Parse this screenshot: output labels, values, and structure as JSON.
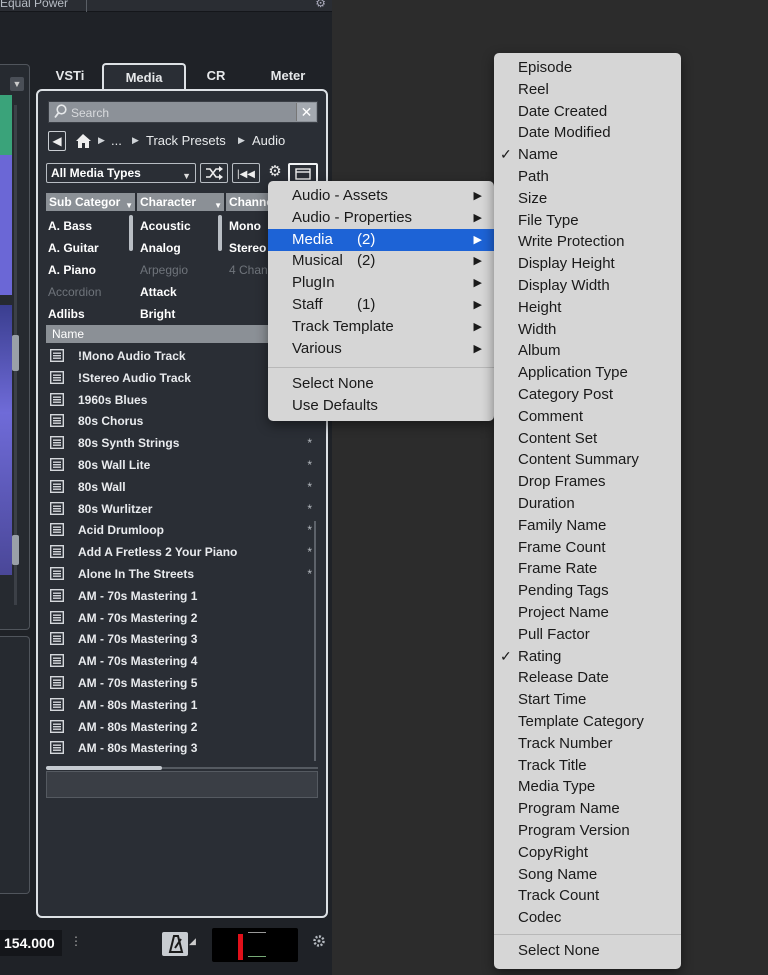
{
  "top_bar": {
    "label": "Equal Power"
  },
  "tabs": [
    {
      "label": "VSTi"
    },
    {
      "label": "Media"
    },
    {
      "label": "CR"
    },
    {
      "label": "Meter"
    }
  ],
  "search": {
    "placeholder": "Search"
  },
  "breadcrumb": {
    "ellipsis": "...",
    "item1": "Track Presets",
    "item2": "Audio"
  },
  "toolbar": {
    "media_type": "All Media Types"
  },
  "filter": {
    "headers": [
      "Sub Categor",
      "Character",
      "Channe"
    ],
    "sub_category": [
      "A. Bass",
      "A. Guitar",
      "A. Piano",
      "Accordion",
      "Adlibs"
    ],
    "character": [
      "Acoustic",
      "Analog",
      "Arpeggio",
      "Attack",
      "Bright"
    ],
    "channel": [
      "Mono",
      "Stereo",
      "4 Chan"
    ]
  },
  "results": {
    "header": "Name",
    "rows": [
      "!Mono Audio Track",
      "!Stereo Audio Track",
      "1960s Blues",
      "80s Chorus",
      "80s Synth Strings",
      "80s Wall Lite",
      "80s Wall",
      "80s Wurlitzer",
      "Acid Drumloop",
      "Add A Fretless 2 Your Piano",
      "Alone In The Streets",
      "AM - 70s Mastering 1",
      "AM - 70s Mastering 2",
      "AM - 70s Mastering 3",
      "AM - 70s Mastering 4",
      "AM - 70s Mastering 5",
      "AM - 80s Mastering 1",
      "AM - 80s Mastering 2",
      "AM - 80s Mastering 3"
    ],
    "star": "*"
  },
  "transport": {
    "tempo": "154.000"
  },
  "category_menu": {
    "items": [
      {
        "label": "Audio - Assets",
        "count": ""
      },
      {
        "label": "Audio - Properties",
        "count": ""
      },
      {
        "label": "Media",
        "count": "(2)"
      },
      {
        "label": "Musical",
        "count": "(2)"
      },
      {
        "label": "PlugIn",
        "count": ""
      },
      {
        "label": "Staff",
        "count": "(1)"
      },
      {
        "label": "Track Template",
        "count": ""
      },
      {
        "label": "Various",
        "count": ""
      }
    ],
    "select_none": "Select None",
    "use_defaults": "Use Defaults",
    "arrow": "▶"
  },
  "attribute_menu": {
    "items": [
      "Episode",
      "Reel",
      "Date Created",
      "Date Modified",
      "Name",
      "Path",
      "Size",
      "File Type",
      "Write Protection",
      "Display Height",
      "Display Width",
      "Height",
      "Width",
      "Album",
      "Application Type",
      "Category Post",
      "Comment",
      "Content Set",
      "Content Summary",
      "Drop Frames",
      "Duration",
      "Family Name",
      "Frame Count",
      "Frame Rate",
      "Pending Tags",
      "Project Name",
      "Pull Factor",
      "Rating",
      "Release Date",
      "Start Time",
      "Template Category",
      "Track Number",
      "Track Title",
      "Media Type",
      "Program Name",
      "Program Version",
      "CopyRight",
      "Song Name",
      "Track Count",
      "Codec"
    ],
    "checked": [
      "Name",
      "Rating"
    ],
    "check_mark": "✓",
    "select_none": "Select None"
  }
}
